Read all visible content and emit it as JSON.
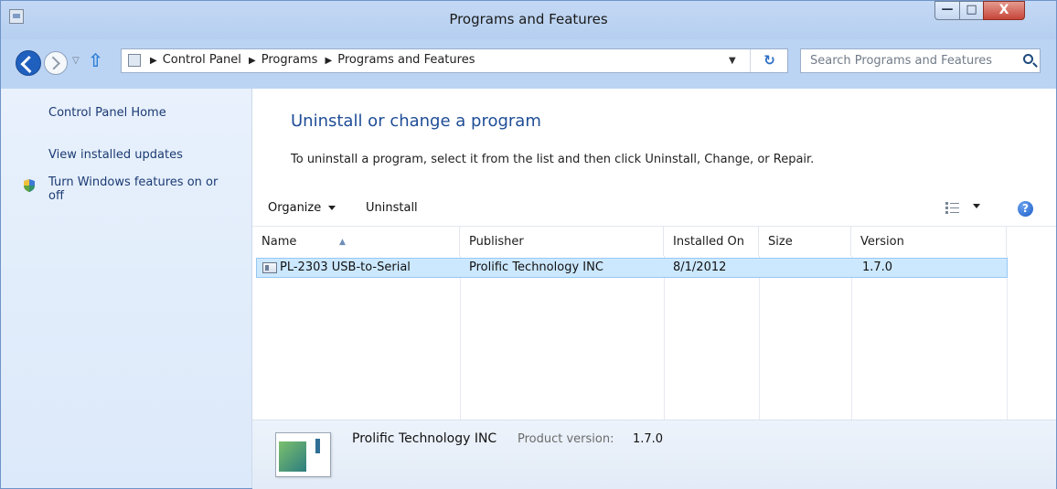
{
  "window": {
    "title": "Programs and Features",
    "minimize_glyph": "—",
    "maximize_glyph": "□",
    "close_glyph": "X"
  },
  "navigation": {
    "breadcrumb": [
      "Control Panel",
      "Programs",
      "Programs and Features"
    ],
    "breadcrumb_separator": "▶",
    "dropdown_glyph": "▼",
    "refresh_glyph": "↻",
    "up_glyph": "⇧",
    "recent_glyph": "▽",
    "search_placeholder": "Search Programs and Features"
  },
  "sidebar": {
    "items": [
      {
        "label": "Control Panel Home"
      },
      {
        "label": "View installed updates"
      },
      {
        "label": "Turn Windows features on or off",
        "icon": "shield-icon"
      }
    ]
  },
  "main": {
    "title": "Uninstall or change a program",
    "description": "To uninstall a program, select it from the list and then click Uninstall, Change, or Repair.",
    "toolbar": {
      "organize_label": "Organize",
      "uninstall_label": "Uninstall",
      "view_icon": "view-options-icon",
      "help_label": "?"
    },
    "table": {
      "columns": [
        "Name",
        "Publisher",
        "Installed On",
        "Size",
        "Version"
      ],
      "rows": [
        {
          "name": "PL-2303 USB-to-Serial",
          "publisher": "Prolific Technology INC",
          "installed_on": "8/1/2012",
          "size": "",
          "version": "1.7.0",
          "selected": true
        }
      ],
      "sort_indicator": "▲"
    },
    "details": {
      "publisher": "Prolific Technology INC",
      "version_label": "Product version:",
      "version": "1.7.0"
    }
  },
  "colors": {
    "accent": "#1f4d96",
    "selection": "#cce8ff",
    "sidebar_bg": "#e8f1fc",
    "titlebar_bg": "#bcd4f3"
  }
}
